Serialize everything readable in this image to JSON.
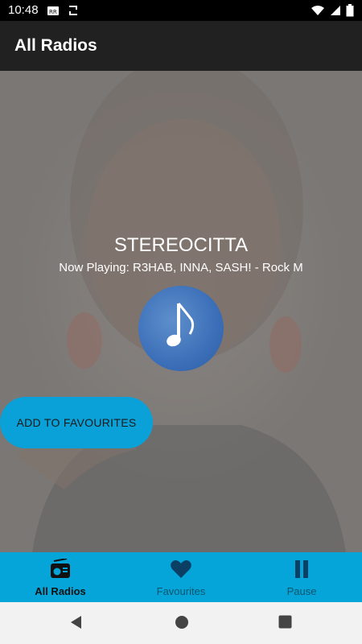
{
  "status_bar": {
    "time": "10:48"
  },
  "app_bar": {
    "title": "All Radios"
  },
  "player": {
    "station": "STEREOCITTA",
    "now_playing": "Now Playing: R3HAB, INNA, SASH! - Rock M"
  },
  "actions": {
    "add_favourites_label": "ADD TO FAVOURITES"
  },
  "bottom_nav": {
    "items": [
      {
        "label": "All Radios",
        "icon": "radio-icon",
        "active": true
      },
      {
        "label": "Favourites",
        "icon": "heart-icon",
        "active": false
      },
      {
        "label": "Pause",
        "icon": "pause-icon",
        "active": false
      }
    ]
  },
  "colors": {
    "app_bar": "#212121",
    "accent": "#06a5d9",
    "fav_button": "#0aa0d8",
    "disc": "#3b6fb8"
  }
}
